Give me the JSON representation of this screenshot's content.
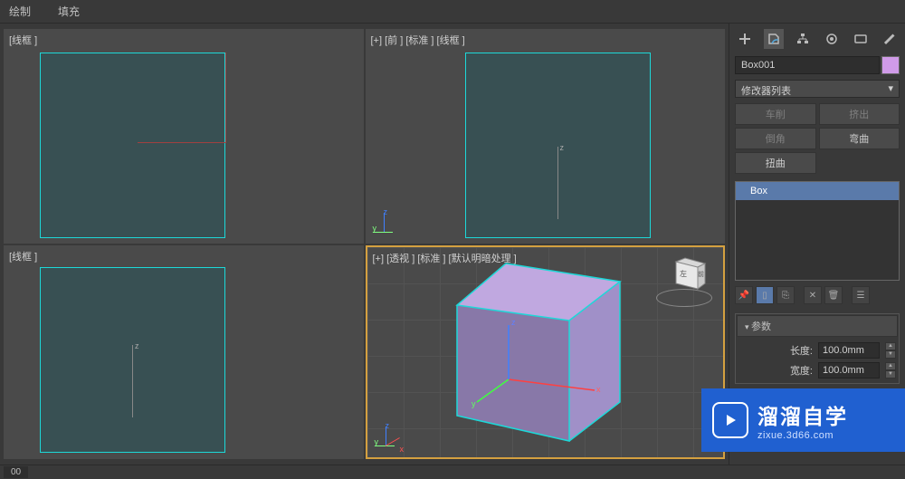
{
  "menu": {
    "draw": "绘制",
    "fill": "填充"
  },
  "viewports": {
    "top_left": "[线框 ]",
    "top_right": "[+] [前 ] [标准 ] [线框 ]",
    "bottom_left": "[线框 ]",
    "bottom_right": "[+] [透视 ] [标准 ] [默认明暗处理 ]"
  },
  "panel": {
    "object_name": "Box001",
    "modifier_list": "修改器列表",
    "buttons": {
      "lathe": "车削",
      "extrude": "挤出",
      "chamfer": "倒角",
      "bend": "弯曲",
      "twist": "扭曲"
    },
    "stack_item": "Box",
    "rollout_params": "参数",
    "length_label": "长度:",
    "length_value": "100.0mm",
    "width_label": "宽度:",
    "width_value": "100.0mm"
  },
  "statusbar": {
    "frame": "00"
  },
  "watermark": {
    "main": "溜溜自学",
    "sub": "zixue.3d66.com"
  }
}
